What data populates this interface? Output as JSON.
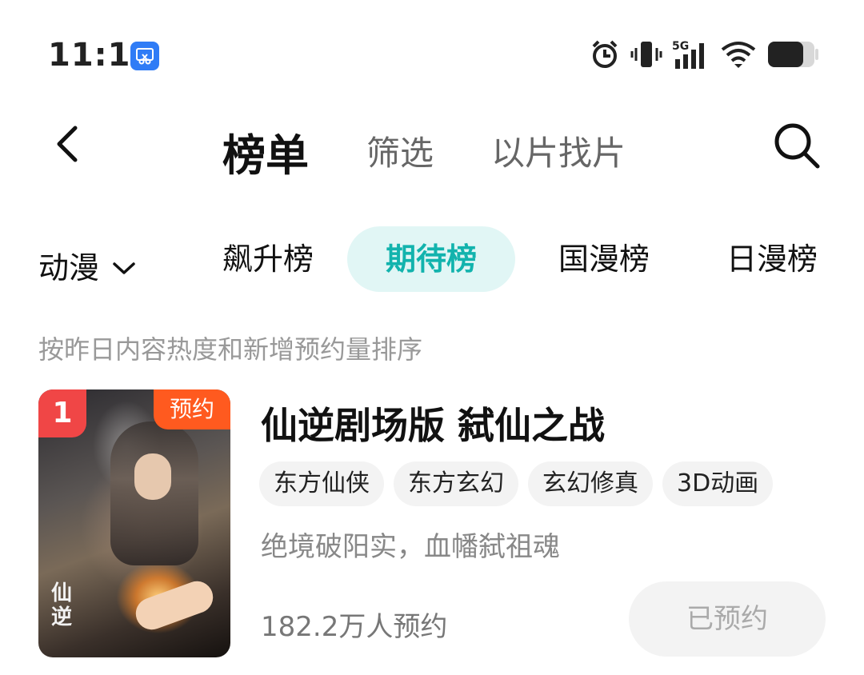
{
  "status_bar": {
    "time": "11:11",
    "app_icon": "screen-cast-icon",
    "icons": [
      "alarm-icon",
      "vibrate-icon",
      "signal-5g-icon",
      "wifi-icon",
      "battery-icon"
    ],
    "network_label": "5G"
  },
  "header": {
    "back_icon": "back-arrow-icon",
    "tabs": [
      {
        "label": "榜单",
        "active": true
      },
      {
        "label": "筛选",
        "active": false
      },
      {
        "label": "以片找片",
        "active": false
      }
    ],
    "search_icon": "search-icon"
  },
  "category": {
    "dropdown_label": "动漫",
    "dropdown_icon": "chevron-down-icon",
    "pills": [
      {
        "label": "飙升榜",
        "active": false
      },
      {
        "label": "期待榜",
        "active": true
      },
      {
        "label": "国漫榜",
        "active": false
      },
      {
        "label": "日漫榜",
        "active": false
      }
    ]
  },
  "subtitle": "按昨日内容热度和新增预约量排序",
  "items": [
    {
      "rank": "1",
      "badge": "预约",
      "poster_text": "仙逆",
      "title": "仙逆剧场版 弑仙之战",
      "tags": [
        "东方仙侠",
        "东方玄幻",
        "玄幻修真",
        "3D动画"
      ],
      "description": "绝境破阳实，血幡弑祖魂",
      "reservations": "182.2万人预约",
      "action_label": "已预约"
    }
  ],
  "colors": {
    "accent": "#12b3ad",
    "accent_bg": "#e1f6f5",
    "rank_red": "#f04646",
    "badge_orange": "#ff5a1f"
  }
}
